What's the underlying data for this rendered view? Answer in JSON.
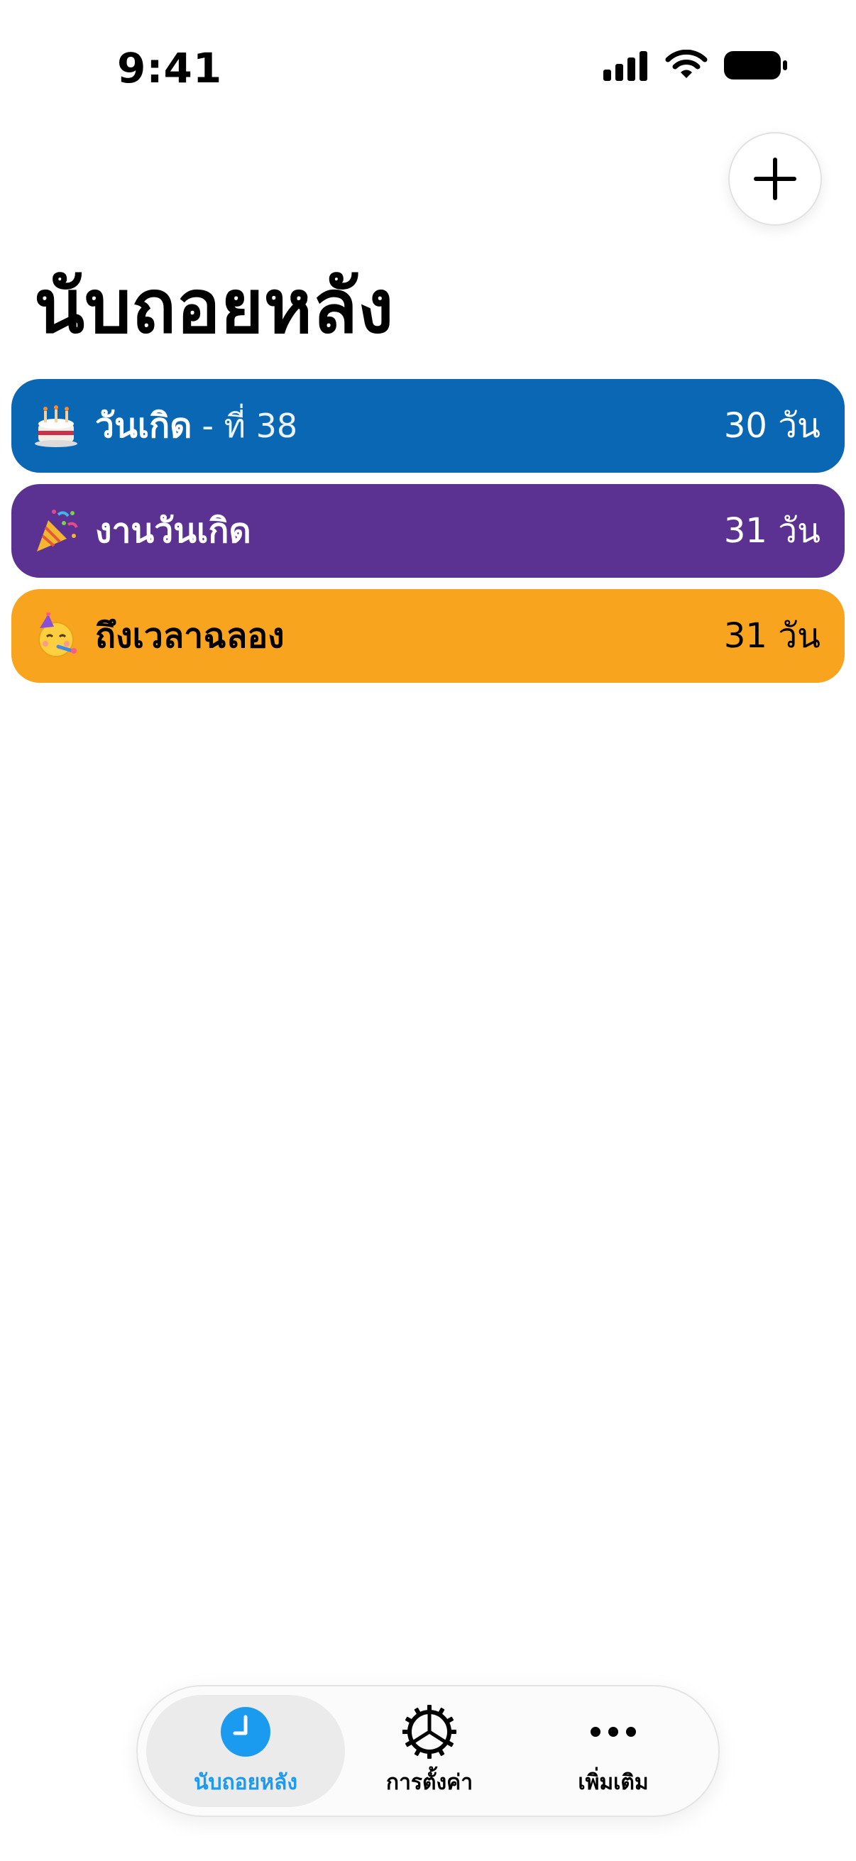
{
  "status_bar": {
    "time": "9:41"
  },
  "header": {
    "title": "นับถอยหลัง",
    "add_icon": "plus-icon"
  },
  "countdowns": [
    {
      "emoji": "birthday-cake-icon",
      "title": "วันเกิด",
      "subtitle": "- ที่ 38",
      "days": "30 วัน",
      "color": "#0967b4",
      "text_color": "#ffffff"
    },
    {
      "emoji": "party-popper-icon",
      "title": "งานวันเกิด",
      "subtitle": "",
      "days": "31 วัน",
      "color": "#5b3191",
      "text_color": "#ffffff"
    },
    {
      "emoji": "partying-face-icon",
      "title": "ถึงเวลาฉลอง",
      "subtitle": "",
      "days": "31 วัน",
      "color": "#f8a41e",
      "text_color": "#000000"
    }
  ],
  "tab_bar": {
    "tabs": [
      {
        "label": "นับถอยหลัง",
        "icon": "clock-icon",
        "active": true
      },
      {
        "label": "การตั้งค่า",
        "icon": "gear-icon",
        "active": false
      },
      {
        "label": "เพิ่มเติม",
        "icon": "more-dots-icon",
        "active": false
      }
    ],
    "active_color": "#1a9bf0"
  }
}
